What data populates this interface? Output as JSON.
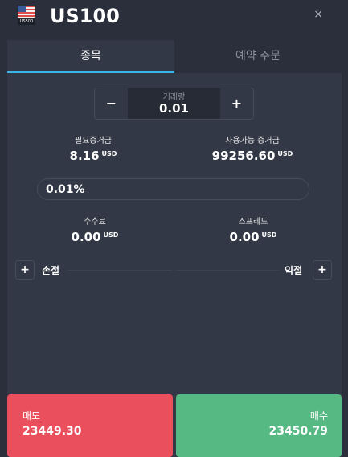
{
  "header": {
    "flag_label": "US500",
    "symbol": "US100",
    "close_glyph": "×"
  },
  "tabs": [
    {
      "label": "종목",
      "active": true
    },
    {
      "label": "예약 주문",
      "active": false
    }
  ],
  "quantity": {
    "minus": "−",
    "plus": "+",
    "label": "거래량",
    "value": "0.01"
  },
  "required_margin": {
    "label": "필요증거금",
    "value": "8.16",
    "unit": "USD"
  },
  "available_margin": {
    "label": "사용가능 증거금",
    "value": "99256.60",
    "unit": "USD"
  },
  "margin_percent": "0.01%",
  "commission": {
    "label": "수수료",
    "value": "0.00",
    "unit": "USD"
  },
  "spread": {
    "label": "스프레드",
    "value": "0.00",
    "unit": "USD"
  },
  "stop_loss": {
    "plus": "+",
    "label": "손절"
  },
  "take_profit": {
    "plus": "+",
    "label": "익절"
  },
  "sell": {
    "label": "매도",
    "price": "23449.30"
  },
  "buy": {
    "label": "매수",
    "price": "23450.79"
  },
  "colors": {
    "background": "#323845",
    "header": "#2a2f3b",
    "tab_accent": "#3ab5e6",
    "sell": "#e94f5c",
    "buy": "#56b883"
  },
  "icons": {
    "flag": "us-flag-icon",
    "close": "close-icon",
    "minus": "minus-icon",
    "plus": "plus-icon"
  }
}
